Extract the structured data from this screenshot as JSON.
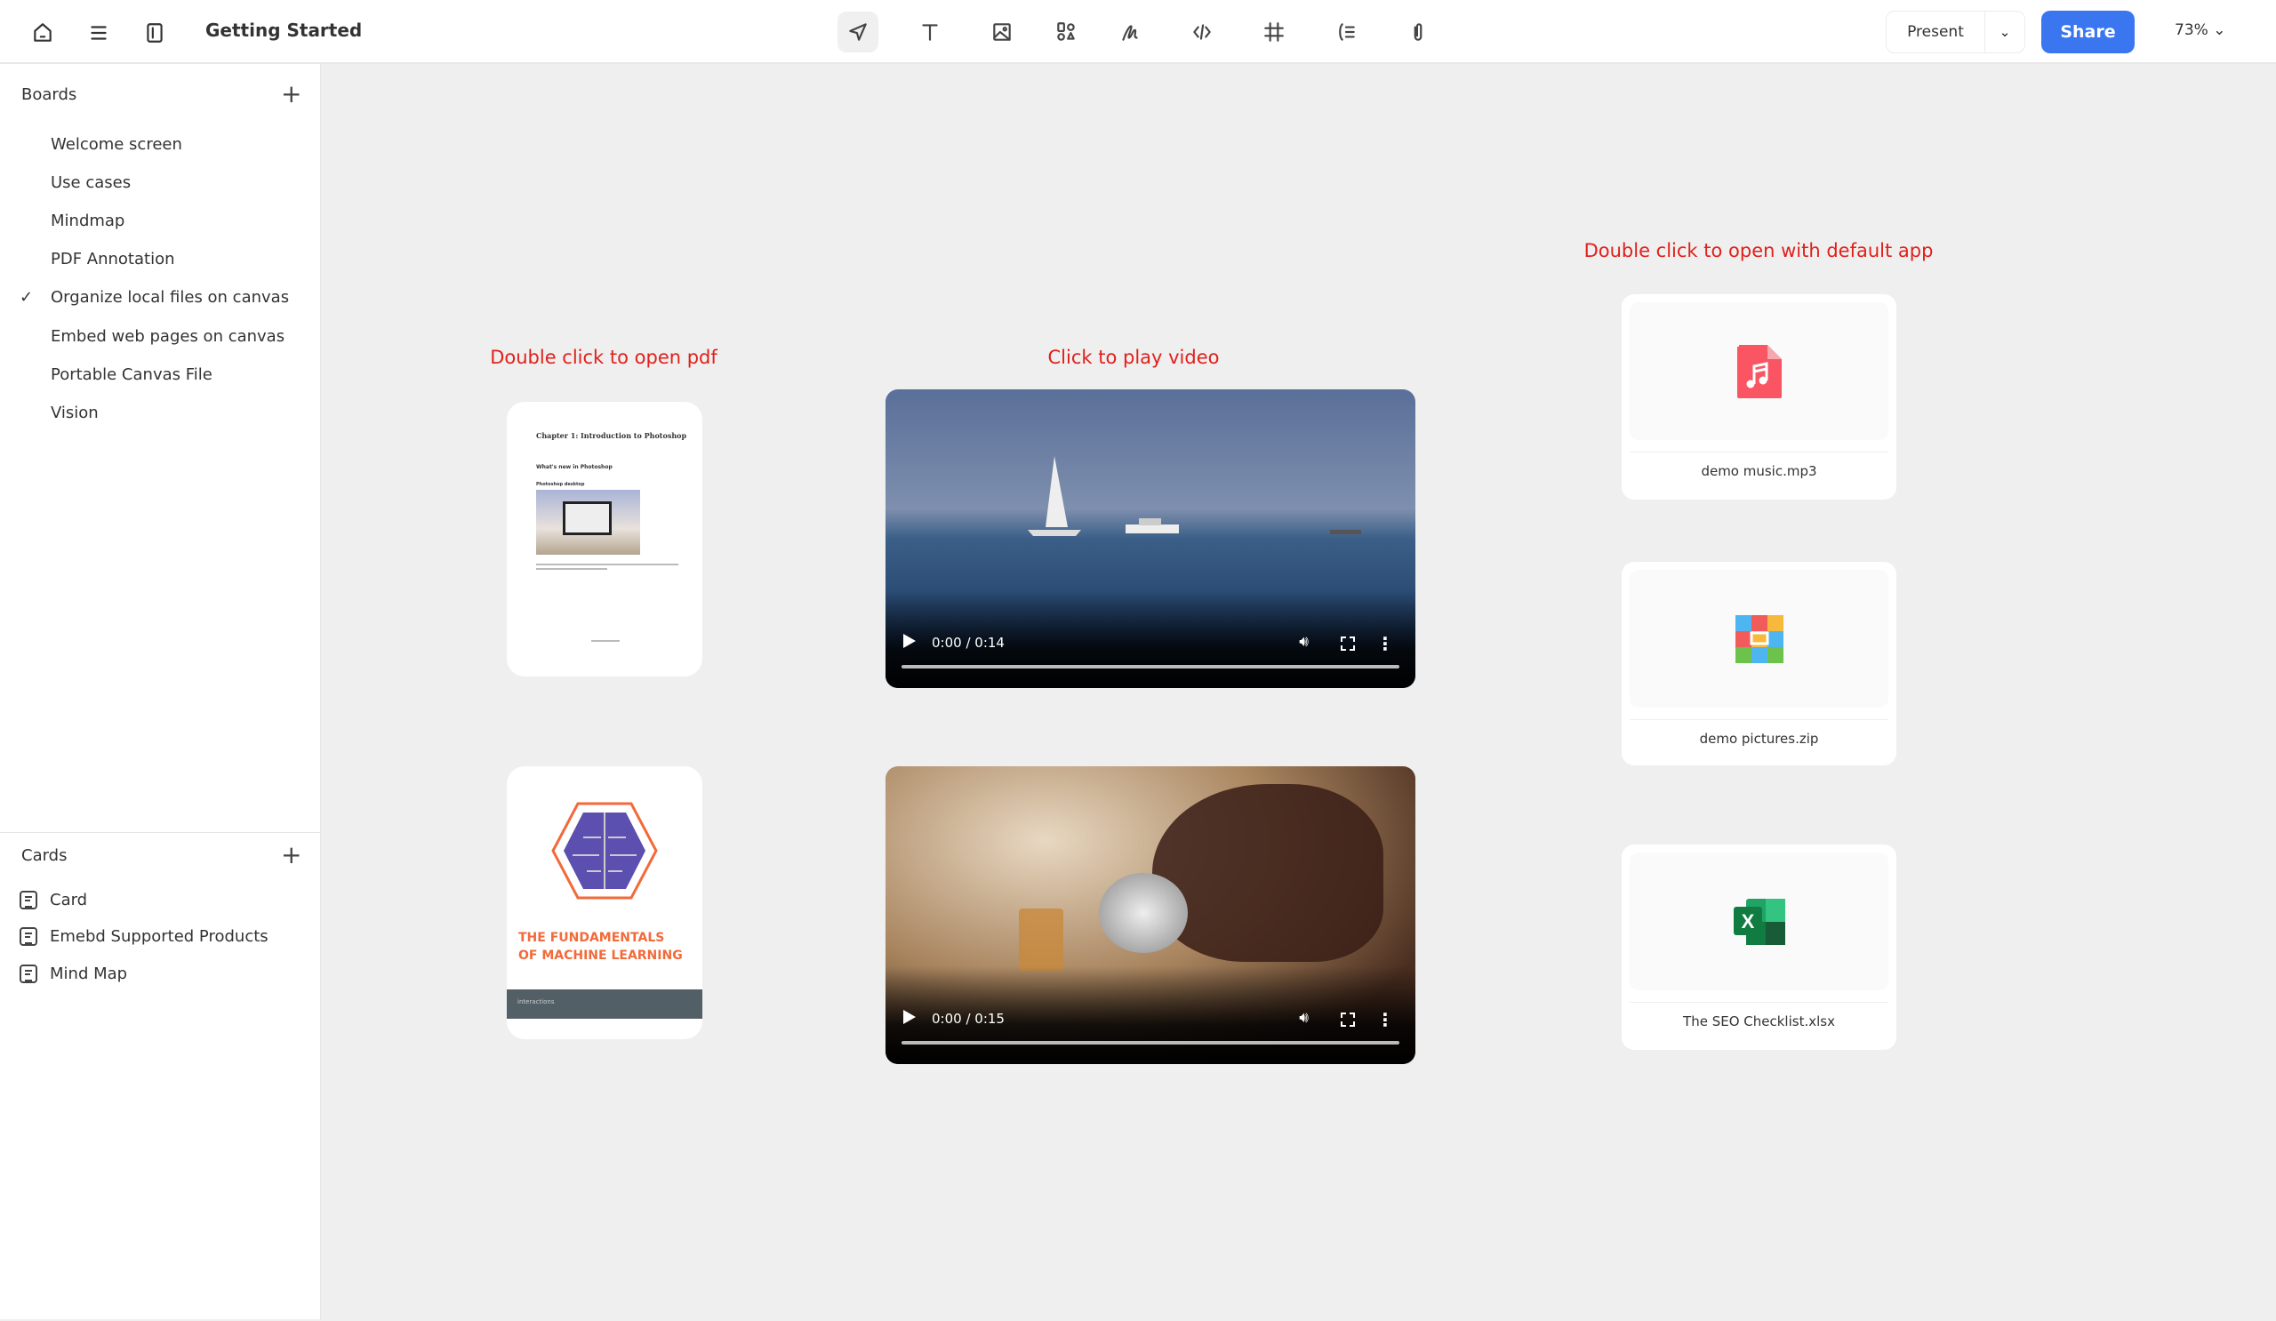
{
  "header": {
    "title": "Getting Started",
    "present_label": "Present",
    "share_label": "Share",
    "zoom": "73%",
    "tools": [
      "select-tool",
      "text-tool",
      "image-tool",
      "shapes-tool",
      "pen-tool",
      "embed-code-tool",
      "frame-tool",
      "mindmap-tool",
      "attach-tool"
    ]
  },
  "sidebar": {
    "boards_label": "Boards",
    "boards": [
      {
        "label": "Welcome screen"
      },
      {
        "label": "Use cases"
      },
      {
        "label": "Mindmap"
      },
      {
        "label": "PDF Annotation"
      },
      {
        "label": "Organize local files on canvas",
        "active": true
      },
      {
        "label": "Embed web pages on canvas"
      },
      {
        "label": "Portable Canvas File"
      },
      {
        "label": "Vision"
      }
    ],
    "cards_label": "Cards",
    "cards": [
      {
        "label": "Card"
      },
      {
        "label": "Emebd Supported Products"
      },
      {
        "label": "Mind Map"
      }
    ]
  },
  "canvas": {
    "pdf_hint": "Double click to open pdf",
    "video_hint": "Click to play video",
    "app_hint": "Double click to open with default app",
    "pdf1": {
      "heading": "Chapter 1: Introduction to Photoshop",
      "subheading": "What's new in Photoshop",
      "caption": "Photoshop desktop"
    },
    "pdf2": {
      "title_line1": "THE FUNDAMENTALS",
      "title_line2": "OF MACHINE LEARNING",
      "publisher": "interactions"
    },
    "videos": [
      {
        "time": "0:00 / 0:14"
      },
      {
        "time": "0:00 / 0:15"
      }
    ],
    "files": [
      {
        "name": "demo music.mp3",
        "icon": "audio-file-icon",
        "color": "#f95563"
      },
      {
        "name": "demo pictures.zip",
        "icon": "zip-file-icon"
      },
      {
        "name": "The SEO Checklist.xlsx",
        "icon": "excel-file-icon",
        "color": "#1e7145"
      }
    ],
    "hint_color": "#e0201b",
    "accent": "#3a76f0"
  }
}
